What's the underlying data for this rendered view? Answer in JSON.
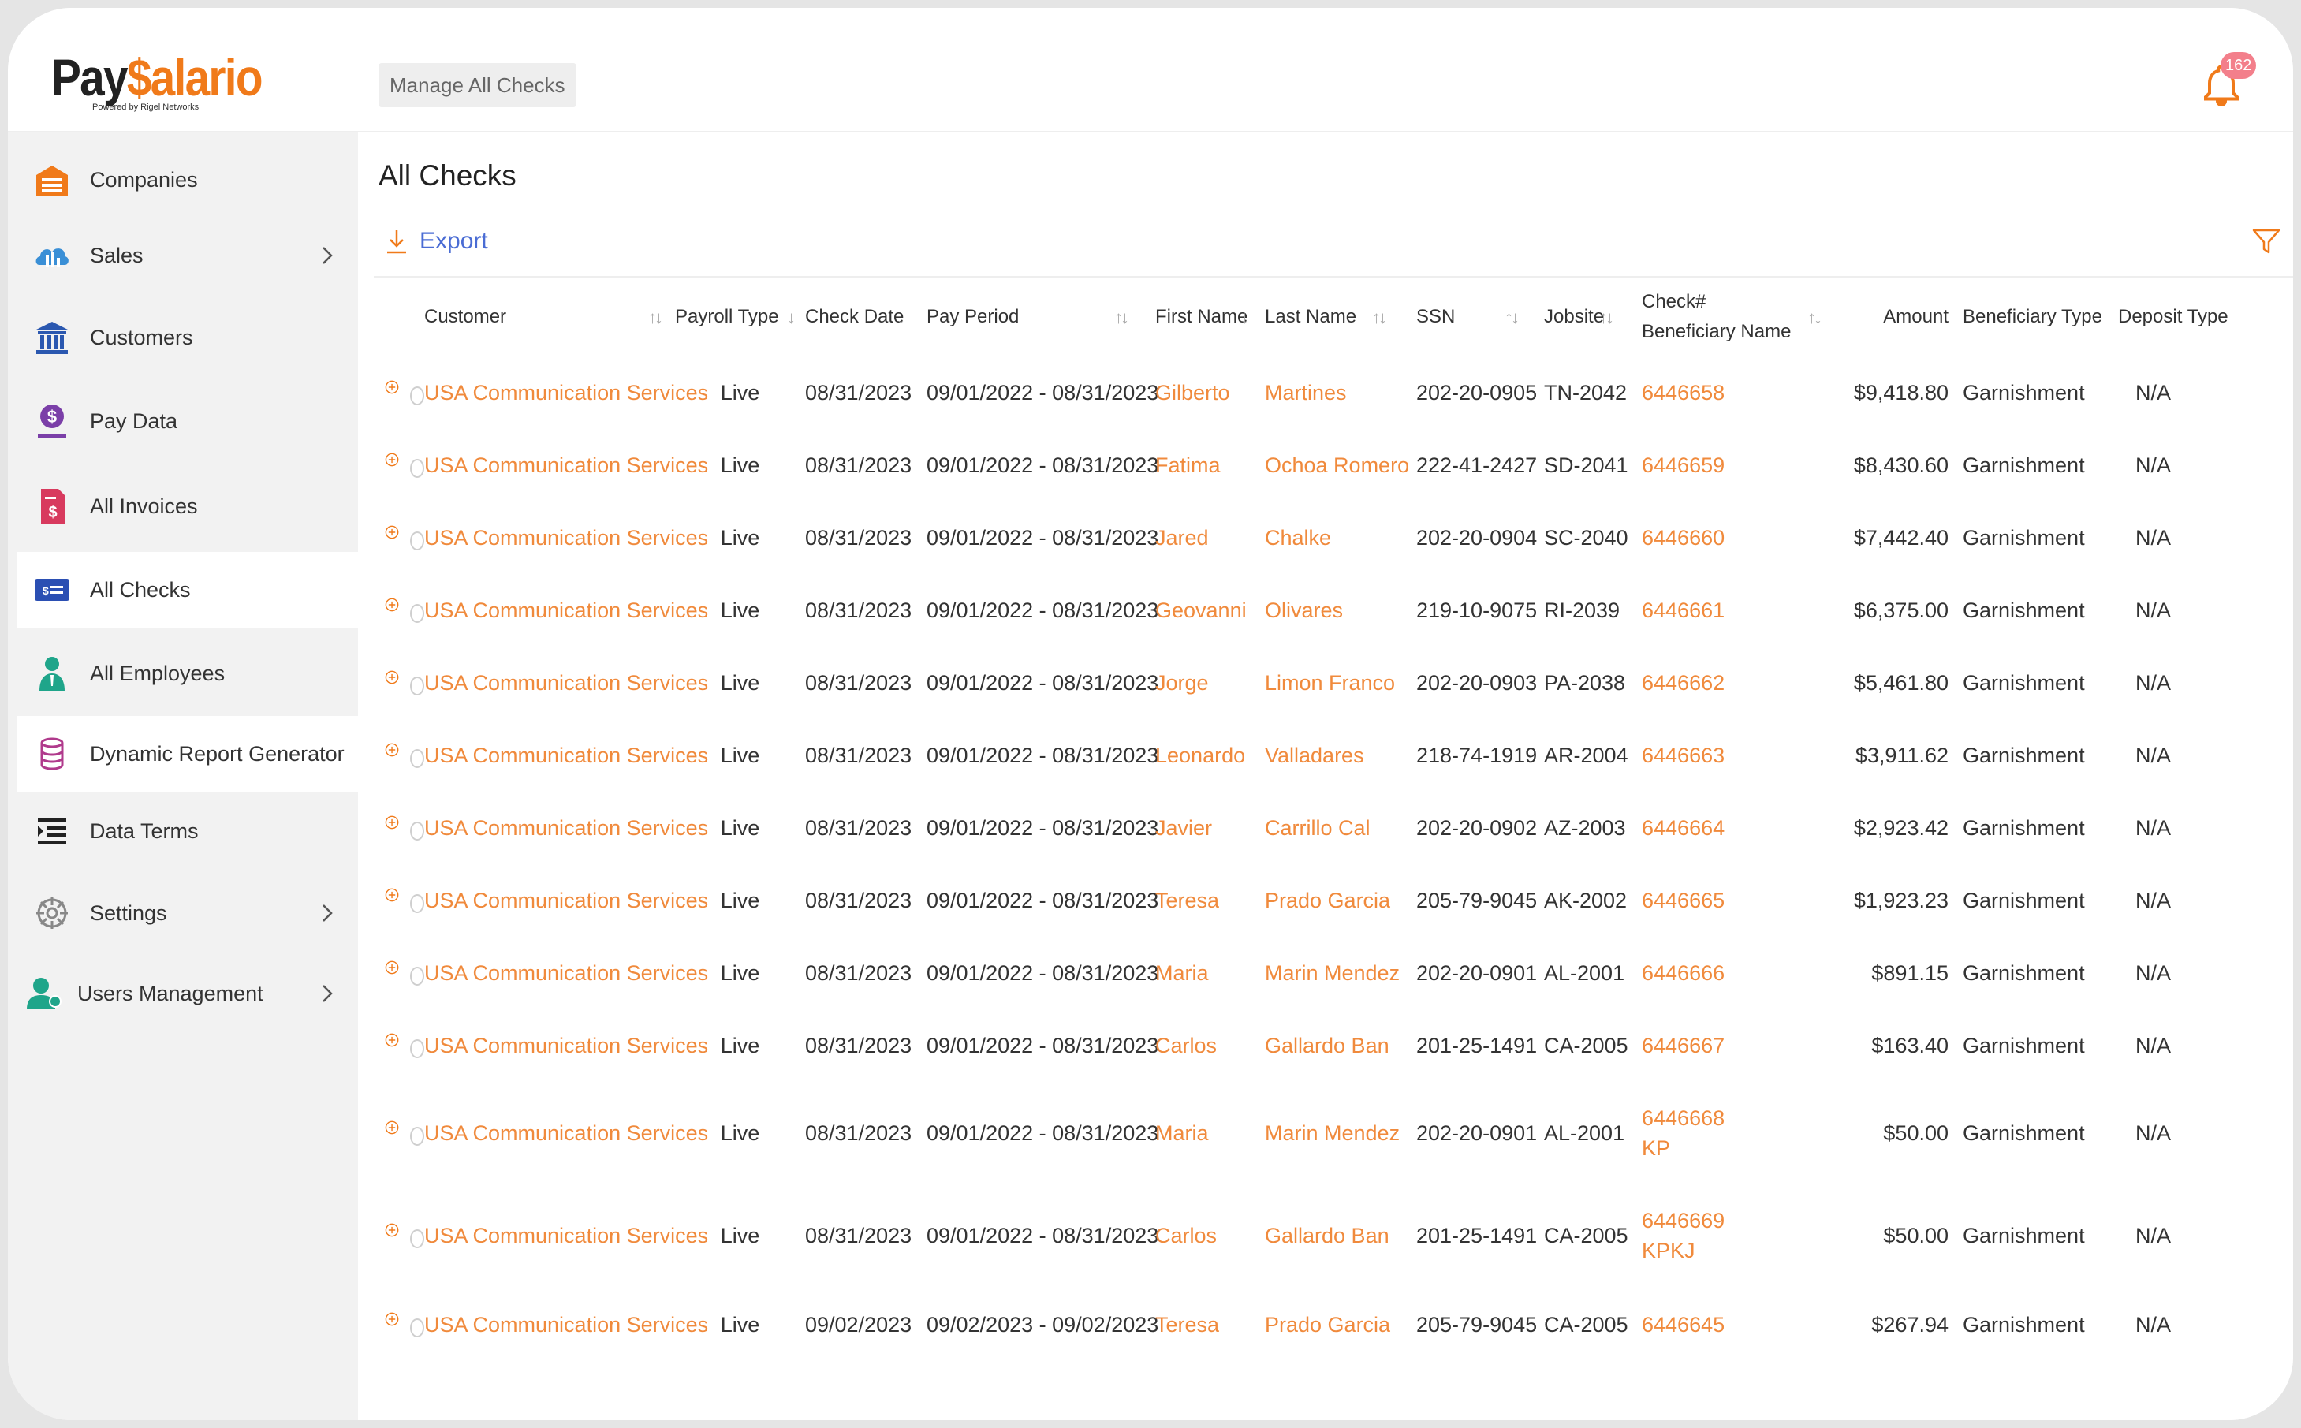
{
  "app": {
    "logo": {
      "part1": "Pay",
      "part2": "$alario",
      "tagline": "Powered by Rigel Networks"
    },
    "breadcrumb": "Manage All Checks",
    "notifications": {
      "count": "162"
    }
  },
  "sidebar": {
    "items": [
      {
        "label": "Companies",
        "icon": "warehouse-icon"
      },
      {
        "label": "Sales",
        "icon": "sales-chart-icon",
        "has_submenu": true
      },
      {
        "label": "Customers",
        "icon": "bank-icon"
      },
      {
        "label": "Pay Data",
        "icon": "money-hand-icon"
      },
      {
        "label": "All Invoices",
        "icon": "invoice-icon"
      },
      {
        "label": "All Checks",
        "icon": "check-icon",
        "active": true
      },
      {
        "label": "All Employees",
        "icon": "employee-icon"
      },
      {
        "label": "Dynamic Report Generator",
        "icon": "database-icon",
        "active": true
      },
      {
        "label": "Data Terms",
        "icon": "list-icon"
      },
      {
        "label": "Settings",
        "icon": "gear-icon",
        "has_submenu": true
      },
      {
        "label": "Users Management",
        "icon": "user-management-icon",
        "has_submenu": true
      }
    ]
  },
  "main": {
    "title": "All Checks",
    "export_label": "Export",
    "columns": {
      "customer": "Customer",
      "payroll_type": "Payroll Type",
      "check_date": "Check Date",
      "pay_period": "Pay Period",
      "first_name": "First Name",
      "last_name": "Last Name",
      "ssn": "SSN",
      "jobsite": "Jobsite",
      "check_no": "Check#",
      "beneficiary_name": "Beneficiary Name",
      "amount": "Amount",
      "beneficiary_type": "Beneficiary Type",
      "deposit_type": "Deposit Type"
    },
    "rows": [
      {
        "customer": "USA Communication Services",
        "payroll_type": "Live",
        "check_date": "08/31/2023",
        "pay_period": "09/01/2022 - 08/31/2023",
        "first_name": "Gilberto",
        "last_name": "Martines",
        "ssn": "202-20-0905",
        "jobsite": "TN-2042",
        "check_no": "6446658",
        "beneficiary_name": "",
        "amount": "$9,418.80",
        "beneficiary_type": "Garnishment",
        "deposit_type": "N/A"
      },
      {
        "customer": "USA Communication Services",
        "payroll_type": "Live",
        "check_date": "08/31/2023",
        "pay_period": "09/01/2022 - 08/31/2023",
        "first_name": "Fatima",
        "last_name": "Ochoa Romero",
        "ssn": "222-41-2427",
        "jobsite": "SD-2041",
        "check_no": "6446659",
        "beneficiary_name": "",
        "amount": "$8,430.60",
        "beneficiary_type": "Garnishment",
        "deposit_type": "N/A"
      },
      {
        "customer": "USA Communication Services",
        "payroll_type": "Live",
        "check_date": "08/31/2023",
        "pay_period": "09/01/2022 - 08/31/2023",
        "first_name": "Jared",
        "last_name": "Chalke",
        "ssn": "202-20-0904",
        "jobsite": "SC-2040",
        "check_no": "6446660",
        "beneficiary_name": "",
        "amount": "$7,442.40",
        "beneficiary_type": "Garnishment",
        "deposit_type": "N/A"
      },
      {
        "customer": "USA Communication Services",
        "payroll_type": "Live",
        "check_date": "08/31/2023",
        "pay_period": "09/01/2022 - 08/31/2023",
        "first_name": "Geovanni",
        "last_name": "Olivares",
        "ssn": "219-10-9075",
        "jobsite": "RI-2039",
        "check_no": "6446661",
        "beneficiary_name": "",
        "amount": "$6,375.00",
        "beneficiary_type": "Garnishment",
        "deposit_type": "N/A"
      },
      {
        "customer": "USA Communication Services",
        "payroll_type": "Live",
        "check_date": "08/31/2023",
        "pay_period": "09/01/2022 - 08/31/2023",
        "first_name": "Jorge",
        "last_name": "Limon Franco",
        "ssn": "202-20-0903",
        "jobsite": "PA-2038",
        "check_no": "6446662",
        "beneficiary_name": "",
        "amount": "$5,461.80",
        "beneficiary_type": "Garnishment",
        "deposit_type": "N/A"
      },
      {
        "customer": "USA Communication Services",
        "payroll_type": "Live",
        "check_date": "08/31/2023",
        "pay_period": "09/01/2022 - 08/31/2023",
        "first_name": "Leonardo",
        "last_name": "Valladares",
        "ssn": "218-74-1919",
        "jobsite": "AR-2004",
        "check_no": "6446663",
        "beneficiary_name": "",
        "amount": "$3,911.62",
        "beneficiary_type": "Garnishment",
        "deposit_type": "N/A"
      },
      {
        "customer": "USA Communication Services",
        "payroll_type": "Live",
        "check_date": "08/31/2023",
        "pay_period": "09/01/2022 - 08/31/2023",
        "first_name": "Javier",
        "last_name": "Carrillo Cal",
        "ssn": "202-20-0902",
        "jobsite": "AZ-2003",
        "check_no": "6446664",
        "beneficiary_name": "",
        "amount": "$2,923.42",
        "beneficiary_type": "Garnishment",
        "deposit_type": "N/A"
      },
      {
        "customer": "USA Communication Services",
        "payroll_type": "Live",
        "check_date": "08/31/2023",
        "pay_period": "09/01/2022 - 08/31/2023",
        "first_name": "Teresa",
        "last_name": "Prado Garcia",
        "ssn": "205-79-9045",
        "jobsite": "AK-2002",
        "check_no": "6446665",
        "beneficiary_name": "",
        "amount": "$1,923.23",
        "beneficiary_type": "Garnishment",
        "deposit_type": "N/A"
      },
      {
        "customer": "USA Communication Services",
        "payroll_type": "Live",
        "check_date": "08/31/2023",
        "pay_period": "09/01/2022 - 08/31/2023",
        "first_name": "Maria",
        "last_name": "Marin Mendez",
        "ssn": "202-20-0901",
        "jobsite": "AL-2001",
        "check_no": "6446666",
        "beneficiary_name": "",
        "amount": "$891.15",
        "beneficiary_type": "Garnishment",
        "deposit_type": "N/A"
      },
      {
        "customer": "USA Communication Services",
        "payroll_type": "Live",
        "check_date": "08/31/2023",
        "pay_period": "09/01/2022 - 08/31/2023",
        "first_name": "Carlos",
        "last_name": "Gallardo Ban",
        "ssn": "201-25-1491",
        "jobsite": "CA-2005",
        "check_no": "6446667",
        "beneficiary_name": "",
        "amount": "$163.40",
        "beneficiary_type": "Garnishment",
        "deposit_type": "N/A"
      },
      {
        "customer": "USA Communication Services",
        "payroll_type": "Live",
        "check_date": "08/31/2023",
        "pay_period": "09/01/2022 - 08/31/2023",
        "first_name": "Maria",
        "last_name": "Marin Mendez",
        "ssn": "202-20-0901",
        "jobsite": "AL-2001",
        "check_no": "6446668",
        "beneficiary_name": "KP",
        "amount": "$50.00",
        "beneficiary_type": "Garnishment",
        "deposit_type": "N/A"
      },
      {
        "customer": "USA Communication Services",
        "payroll_type": "Live",
        "check_date": "08/31/2023",
        "pay_period": "09/01/2022 - 08/31/2023",
        "first_name": "Carlos",
        "last_name": "Gallardo Ban",
        "ssn": "201-25-1491",
        "jobsite": "CA-2005",
        "check_no": "6446669",
        "beneficiary_name": "KPKJ",
        "amount": "$50.00",
        "beneficiary_type": "Garnishment",
        "deposit_type": "N/A"
      },
      {
        "customer": "USA Communication Services",
        "payroll_type": "Live",
        "check_date": "09/02/2023",
        "pay_period": "09/02/2023 - 09/02/2023",
        "first_name": "Teresa",
        "last_name": "Prado Garcia",
        "ssn": "205-79-9045",
        "jobsite": "CA-2005",
        "check_no": "6446645",
        "beneficiary_name": "",
        "amount": "$267.94",
        "beneficiary_type": "Garnishment",
        "deposit_type": "N/A"
      }
    ]
  },
  "colors": {
    "accent": "#f08a3c",
    "link_blue": "#4a6cd4",
    "sidebar_bg": "#f2f2f2",
    "badge": "#f37f8b"
  }
}
